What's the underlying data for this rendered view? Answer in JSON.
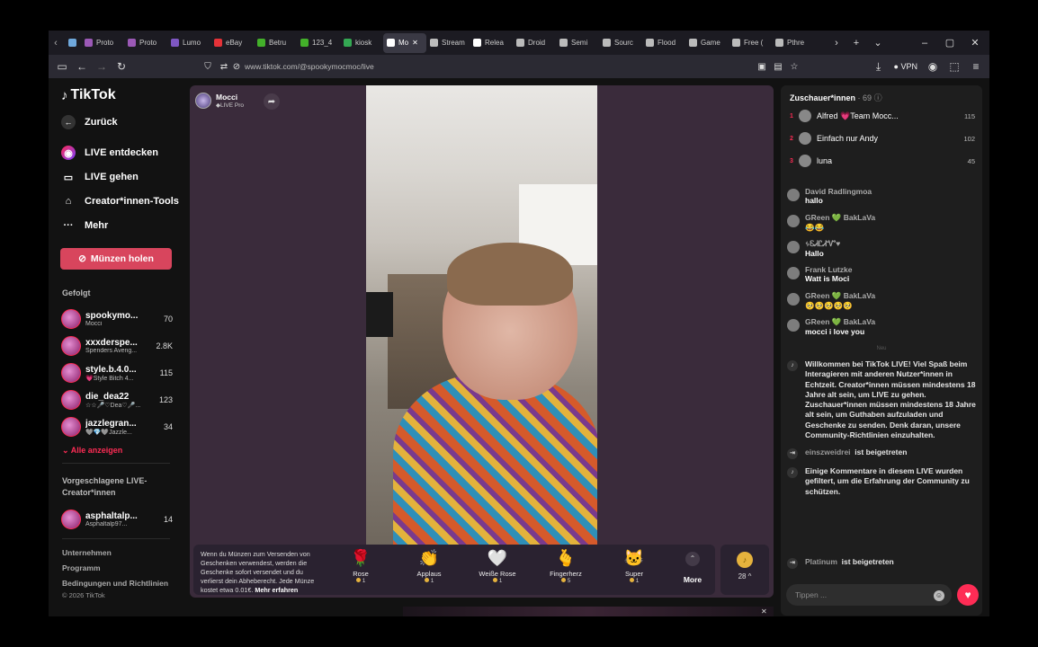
{
  "browser": {
    "tabs": [
      {
        "label": "",
        "color": "#6fa8dc",
        "pinned": true
      },
      {
        "label": "Proto",
        "color": "#9b59b6"
      },
      {
        "label": "Proto",
        "color": "#9b59b6"
      },
      {
        "label": "Lumo",
        "color": "#7e57c2"
      },
      {
        "label": "eBay",
        "color": "#e53238"
      },
      {
        "label": "Betru",
        "color": "#43b02a"
      },
      {
        "label": "123_4",
        "color": "#43b02a"
      },
      {
        "label": "kiosk",
        "color": "#34a853"
      },
      {
        "label": "Mo",
        "color": "#ffffff",
        "active": true
      },
      {
        "label": "Stream",
        "color": "#bbbbbb"
      },
      {
        "label": "Relea",
        "color": "#ffffff"
      },
      {
        "label": "Droid",
        "color": "#bbbbbb"
      },
      {
        "label": "Semi",
        "color": "#bbbbbb"
      },
      {
        "label": "Sourc",
        "color": "#bbbbbb"
      },
      {
        "label": "Flood",
        "color": "#bbbbbb"
      },
      {
        "label": "Game",
        "color": "#bbbbbb"
      },
      {
        "label": "Free (",
        "color": "#bbbbbb"
      },
      {
        "label": "Pthre",
        "color": "#bbbbbb"
      }
    ],
    "url": "www.tiktok.com/@spookymocmoc/live",
    "vpn_label": "VPN"
  },
  "sidebar": {
    "logo": "TikTok",
    "back": "Zurück",
    "menu": [
      {
        "label": "LIVE entdecken",
        "icon": "live-icon"
      },
      {
        "label": "LIVE gehen",
        "icon": "camera-icon"
      },
      {
        "label": "Creator*innen-Tools",
        "icon": "home-icon"
      },
      {
        "label": "Mehr",
        "icon": "more-icon"
      }
    ],
    "coins_button": "Münzen holen",
    "followed_title": "Gefolgt",
    "followed": [
      {
        "name": "spookymo...",
        "sub": "Mocci",
        "count": "70"
      },
      {
        "name": "xxxderspe...",
        "sub": "Spenders Aveng...",
        "count": "2.8K"
      },
      {
        "name": "style.b.4.0...",
        "sub": "💗Style Bitch 4...",
        "count": "115"
      },
      {
        "name": "die_dea22",
        "sub": "☆☆🎤♡Dea♡🎤...",
        "count": "123"
      },
      {
        "name": "jazzlegran...",
        "sub": "🩶💎🩶Jazzle...",
        "count": "34"
      }
    ],
    "show_all": "Alle anzeigen",
    "suggested_title": "Vorgeschlagene LIVE-Creator*innen",
    "suggested": [
      {
        "name": "asphaltalp...",
        "sub": "Asphaltalp97...",
        "count": "14"
      }
    ],
    "footer_links": [
      "Unternehmen",
      "Programm",
      "Bedingungen und Richtlinien"
    ],
    "copyright": "© 2026 TikTok"
  },
  "stream": {
    "host_name": "Mocci",
    "host_badge": "◆LIVE Pro",
    "gift_info": "Wenn du Münzen zum Versenden von Geschenken verwendest, werden die Geschenke sofort versendet und du verlierst dein Abheberecht. Jede Münze kostet etwa 0.01€.",
    "gift_info_link": "Mehr erfahren",
    "gifts": [
      {
        "name": "Rose",
        "price": "1",
        "icon": "🌹"
      },
      {
        "name": "Applaus",
        "price": "1",
        "icon": "👏"
      },
      {
        "name": "Weiße Rose",
        "price": "1",
        "icon": "🤍"
      },
      {
        "name": "Fingerherz",
        "price": "5",
        "icon": "🫰"
      },
      {
        "name": "Super",
        "price": "1",
        "icon": "🐱"
      }
    ],
    "more_label": "More",
    "coins": "28 ^"
  },
  "chat": {
    "viewers_label": "Zuschauer*innen",
    "viewers_count": "· 69",
    "top_viewers": [
      {
        "rank": "1",
        "name": "Alfred 💗Team Mocc...",
        "value": "115"
      },
      {
        "rank": "2",
        "name": "Einfach nur Andy",
        "value": "102"
      },
      {
        "rank": "3",
        "name": "luna",
        "value": "45"
      }
    ],
    "messages": [
      {
        "user": "David Radlingmoa",
        "text": "hallo"
      },
      {
        "user": "GReen 💚 BakLaVa",
        "text": "😂😂"
      },
      {
        "user": "ᛃᏋᏗᏝᏗᏉ♥",
        "text": "Hallo"
      },
      {
        "user": "Frank Lutzke",
        "text": "Watt is Moci"
      },
      {
        "user": "GReen 💚 BakLaVa",
        "text": "🥺🥺🥺🥺🥺"
      },
      {
        "user": "GReen 💚 BakLaVa",
        "text": "mocci i love you"
      }
    ],
    "new_separator": "Neu",
    "system_welcome": "Willkommen bei TikTok LIVE! Viel Spaß beim Interagieren mit anderen Nutzer*innen in Echtzeit. Creator*innen müssen mindestens 18 Jahre alt sein, um LIVE zu gehen. Zuschauer*innen müssen mindestens 18 Jahre alt sein, um Guthaben aufzuladen und Geschenke zu senden. Denk daran, unsere Community-Richtlinien einzuhalten.",
    "join_1_user": "einszweidrei",
    "join_text": "ist beigetreten",
    "system_filtered": "Einige Kommentare in diesem LIVE wurden gefiltert, um die Erfahrung der Community zu schützen.",
    "join_2_user": "Platinum",
    "input_placeholder": "Tippen ..."
  }
}
